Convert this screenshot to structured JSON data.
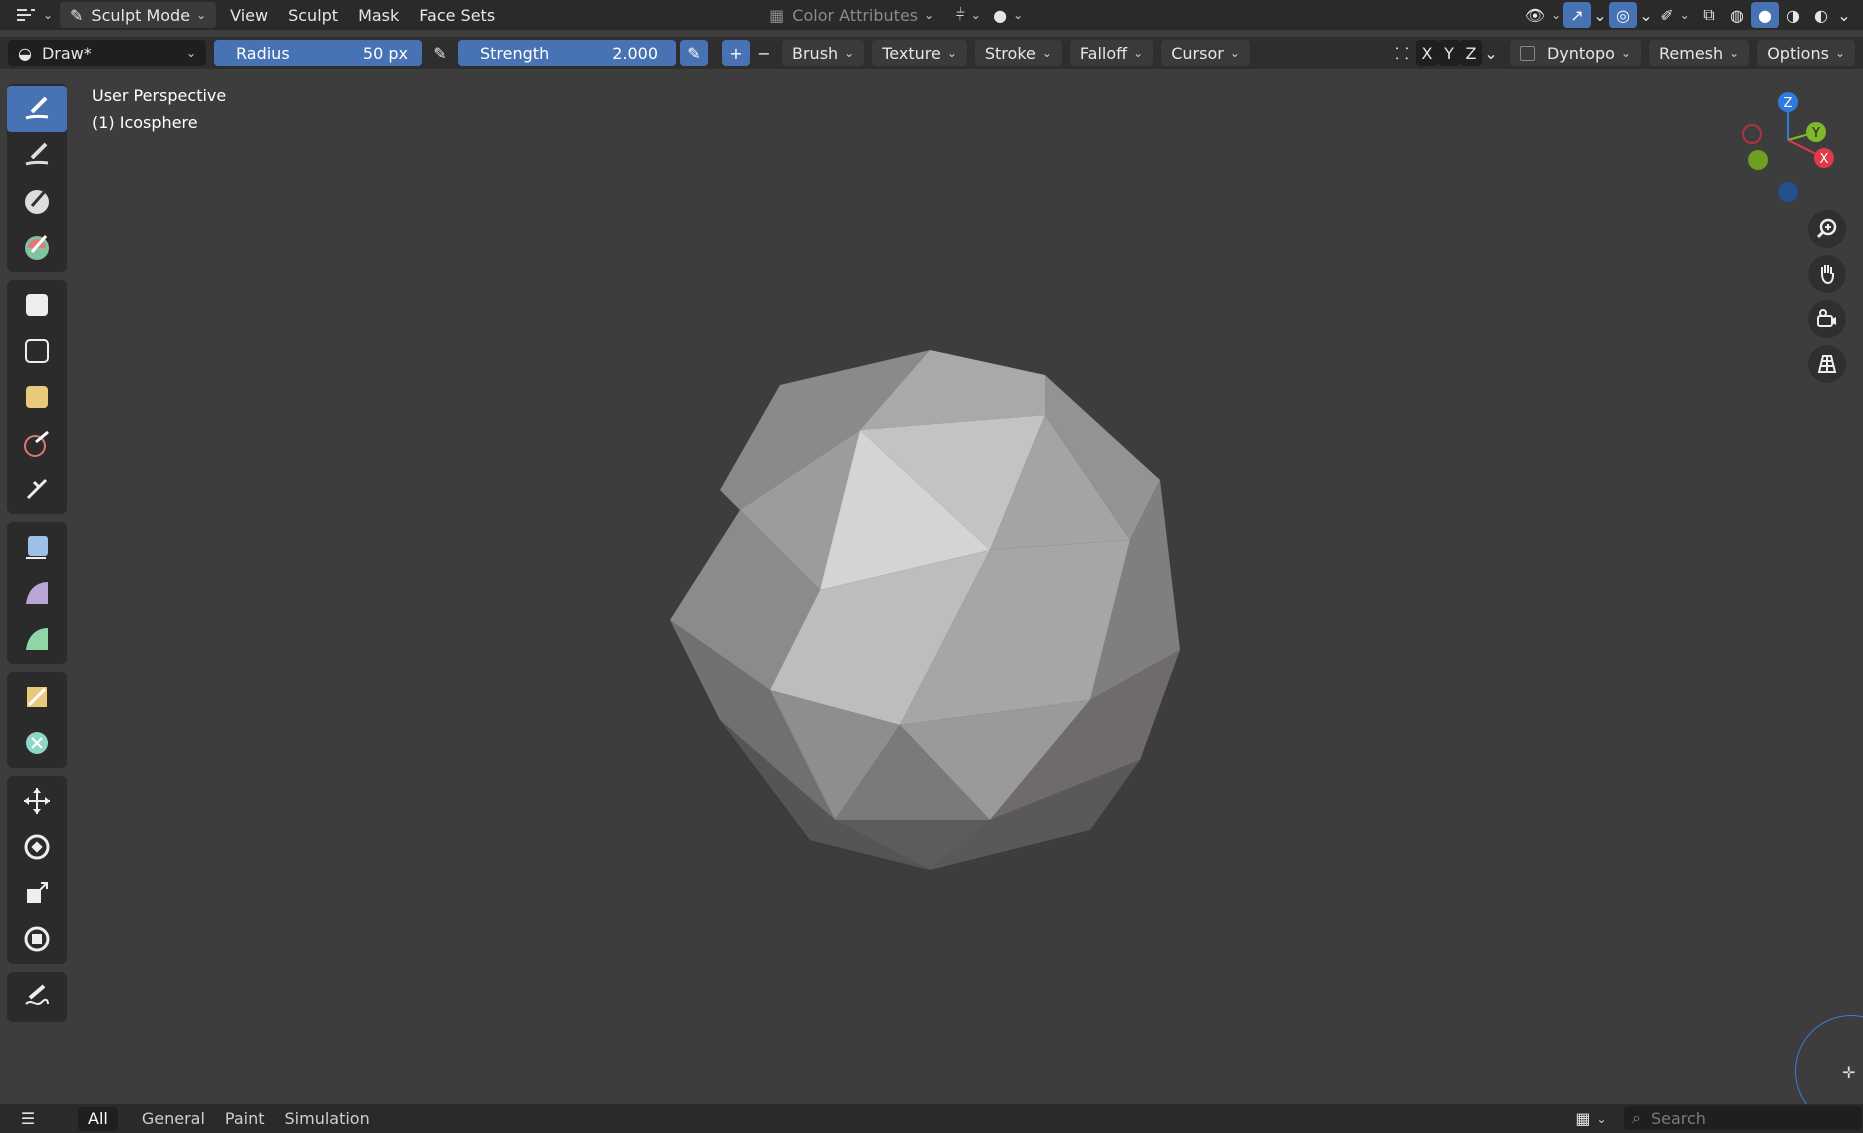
{
  "header": {
    "mode_label": "Sculpt Mode",
    "menus": [
      "View",
      "Sculpt",
      "Mask",
      "Face Sets"
    ],
    "color_attributes_label": "Color Attributes"
  },
  "tool_settings": {
    "brush_name": "Draw*",
    "radius_label": "Radius",
    "radius_value": "50 px",
    "strength_label": "Strength",
    "strength_value": "2.000",
    "menus": [
      "Brush",
      "Texture",
      "Stroke",
      "Falloff",
      "Cursor"
    ],
    "axes": [
      "X",
      "Y",
      "Z"
    ],
    "dyntopo_label": "Dyntopo",
    "remesh_label": "Remesh",
    "options_label": "Options"
  },
  "viewport": {
    "view_name": "User Perspective",
    "object_name": "(1) Icosphere",
    "gizmo": {
      "z": "Z",
      "y": "Y",
      "x": "X"
    }
  },
  "bottom": {
    "tabs": [
      "All",
      "General",
      "Paint",
      "Simulation"
    ],
    "search_placeholder": "Search"
  },
  "colors": {
    "accent": "#4772b3",
    "axis_x": "#e0394c",
    "axis_y": "#7fb82a",
    "axis_z": "#2f7ae0"
  }
}
